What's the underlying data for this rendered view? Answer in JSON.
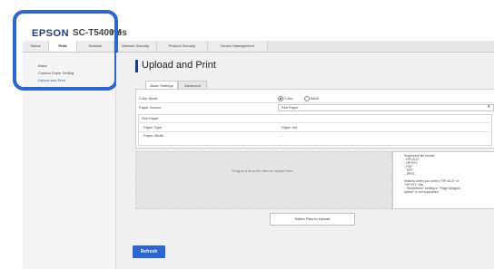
{
  "header": {
    "brand": "EPSON",
    "model": "SC-T5400M",
    "series": "ries"
  },
  "nav": {
    "tabs": [
      {
        "label": "Status"
      },
      {
        "label": "Print"
      },
      {
        "label": "Network"
      },
      {
        "label": "Network Security"
      },
      {
        "label": "Product Security"
      },
      {
        "label": "Device Management"
      }
    ]
  },
  "sidebar": {
    "items": [
      {
        "label": "Basic"
      },
      {
        "label": "Custom Paper Setting"
      },
      {
        "label": "Upload and Print"
      }
    ]
  },
  "main": {
    "title": "Upload and Print",
    "tabs": [
      {
        "label": "Basic Settings"
      },
      {
        "label": "Advanced"
      }
    ],
    "color_mode": {
      "label": "Color Mode",
      "option_color": "Color",
      "option_bw": "B&W"
    },
    "paper_source": {
      "label": "Paper Source",
      "value": "Roll Paper"
    },
    "roll_paper": {
      "section": "Roll Paper",
      "paper_type_label": "Paper Type",
      "paper_type_value": "Paper not",
      "paper_width_label": "Paper Width",
      "paper_width_value": "-"
    },
    "drop_zone": "Drag and drop the files to upload here.",
    "info": [
      "Supported file format",
      "- HP-GL/2",
      "- HP RTL",
      "- PDF",
      "- TIFF",
      "- JPEG",
      "",
      "Notices when you select \"HP-GL/2\" or",
      "\"HP RTL\" file:",
      "- \"Borderless\" setting in \"Page Margins",
      "option\" is not supported."
    ],
    "select_files_button": "Select Files to Upload",
    "refresh_button": "Refresh"
  }
}
